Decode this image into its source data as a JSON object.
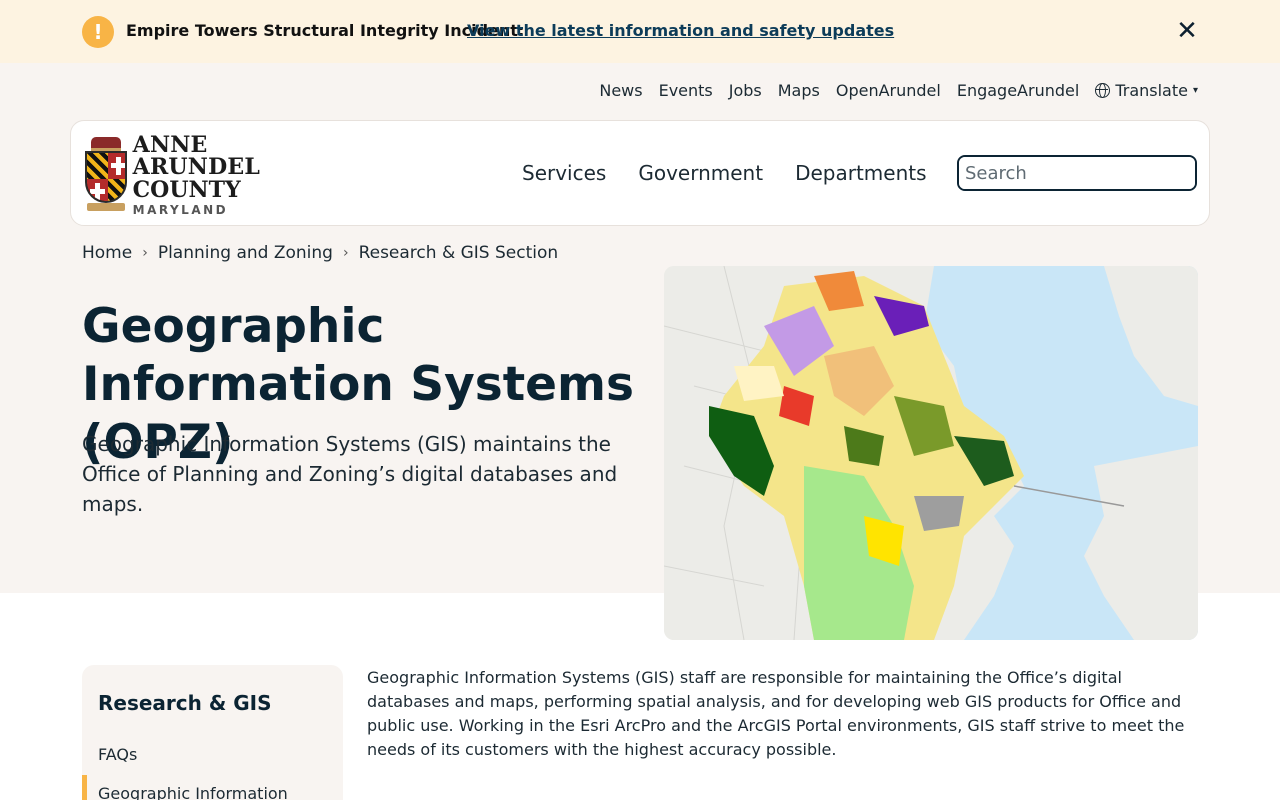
{
  "alert": {
    "icon": "exclamation-icon",
    "icon_glyph": "!",
    "title": "Empire Towers Structural Integrity Incident:",
    "link": "View the latest information and safety updates",
    "close_glyph": "✕"
  },
  "utility_nav": {
    "items": [
      "News",
      "Events",
      "Jobs",
      "Maps",
      "OpenArundel",
      "EngageArundel"
    ],
    "translate": "Translate",
    "caret": "▾"
  },
  "logo": {
    "line1": "ANNE ARUNDEL",
    "line2": "COUNTY",
    "line3": "MARYLAND"
  },
  "main_nav": {
    "items": [
      "Services",
      "Government",
      "Departments"
    ]
  },
  "search": {
    "placeholder": "Search",
    "value": ""
  },
  "breadcrumb": {
    "items": [
      "Home",
      "Planning and Zoning",
      "Research & GIS Section"
    ],
    "separator": "›"
  },
  "hero": {
    "title": "Geographic Information Systems (OPZ)",
    "lead": "Geographic Information Systems (GIS) maintains the Office of Planning and Zoning’s digital databases and maps."
  },
  "sidebar": {
    "title": "Research & GIS",
    "items": [
      "FAQs",
      "Geographic Information"
    ]
  },
  "body": {
    "paragraph": "Geographic Information Systems (GIS) staff are responsible for maintaining the Office’s digital databases and maps, performing spatial analysis, and for developing web GIS products for Office and public use. Working in the Esri ArcPro and the ArcGIS Portal environments, GIS staff strive to meet the needs of its customers with the highest accuracy possible."
  },
  "colors": {
    "alert_bg": "#fdf3e1",
    "alert_icon": "#f8b446",
    "hero_bg": "#f8f4f1",
    "navy": "#0c2434",
    "water": "#c9e6f7",
    "accent_bar": "#f8b446"
  }
}
